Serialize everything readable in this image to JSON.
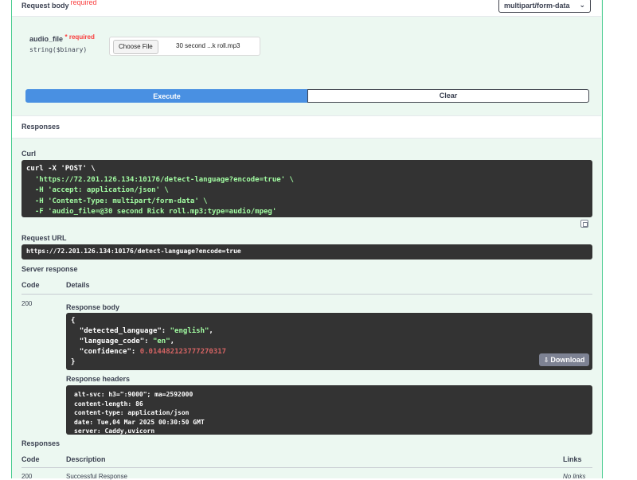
{
  "request_body": {
    "title": "Request body",
    "required": "required",
    "content_type": "multipart/form-data",
    "param": {
      "name": "audio_file",
      "required": "* required",
      "type": "string($binary)",
      "choose_label": "Choose File",
      "file_name": "30 second ...k roll.mp3"
    }
  },
  "buttons": {
    "execute": "Execute",
    "clear": "Clear"
  },
  "responses_heading": "Responses",
  "curl": {
    "label": "Curl",
    "lines": [
      "curl -X 'POST' \\",
      "  'https://72.201.126.134:10176/detect-language?encode=true' \\",
      "  -H 'accept: application/json' \\",
      "  -H 'Content-Type: multipart/form-data' \\",
      "  -F 'audio_file=@30 second Rick roll.mp3;type=audio/mpeg'"
    ]
  },
  "request_url": {
    "label": "Request URL",
    "value": "https://72.201.126.134:10176/detect-language?encode=true"
  },
  "server_response": {
    "label": "Server response",
    "col_code": "Code",
    "col_details": "Details",
    "code": "200",
    "body_label": "Response body",
    "body": {
      "open": "{",
      "detected_language_key": "\"detected_language\"",
      "detected_language_val": "\"english\"",
      "language_code_key": "\"language_code\"",
      "language_code_val": "\"en\"",
      "confidence_key": "\"confidence\"",
      "confidence_val": "0.014482123777270317",
      "close": "}"
    },
    "download_label": "Download",
    "headers_label": "Response headers",
    "headers": [
      "alt-svc: h3=\":9000\"; ma=2592000",
      "content-length: 86",
      "content-type: application/json",
      "date: Tue,04 Mar 2025 00:30:50 GMT",
      "server: Caddy,uvicorn"
    ]
  },
  "responses_table": {
    "label": "Responses",
    "col_code": "Code",
    "col_description": "Description",
    "col_links": "Links",
    "row_code": "200",
    "row_description": "Successful Response",
    "row_links": "No links"
  }
}
